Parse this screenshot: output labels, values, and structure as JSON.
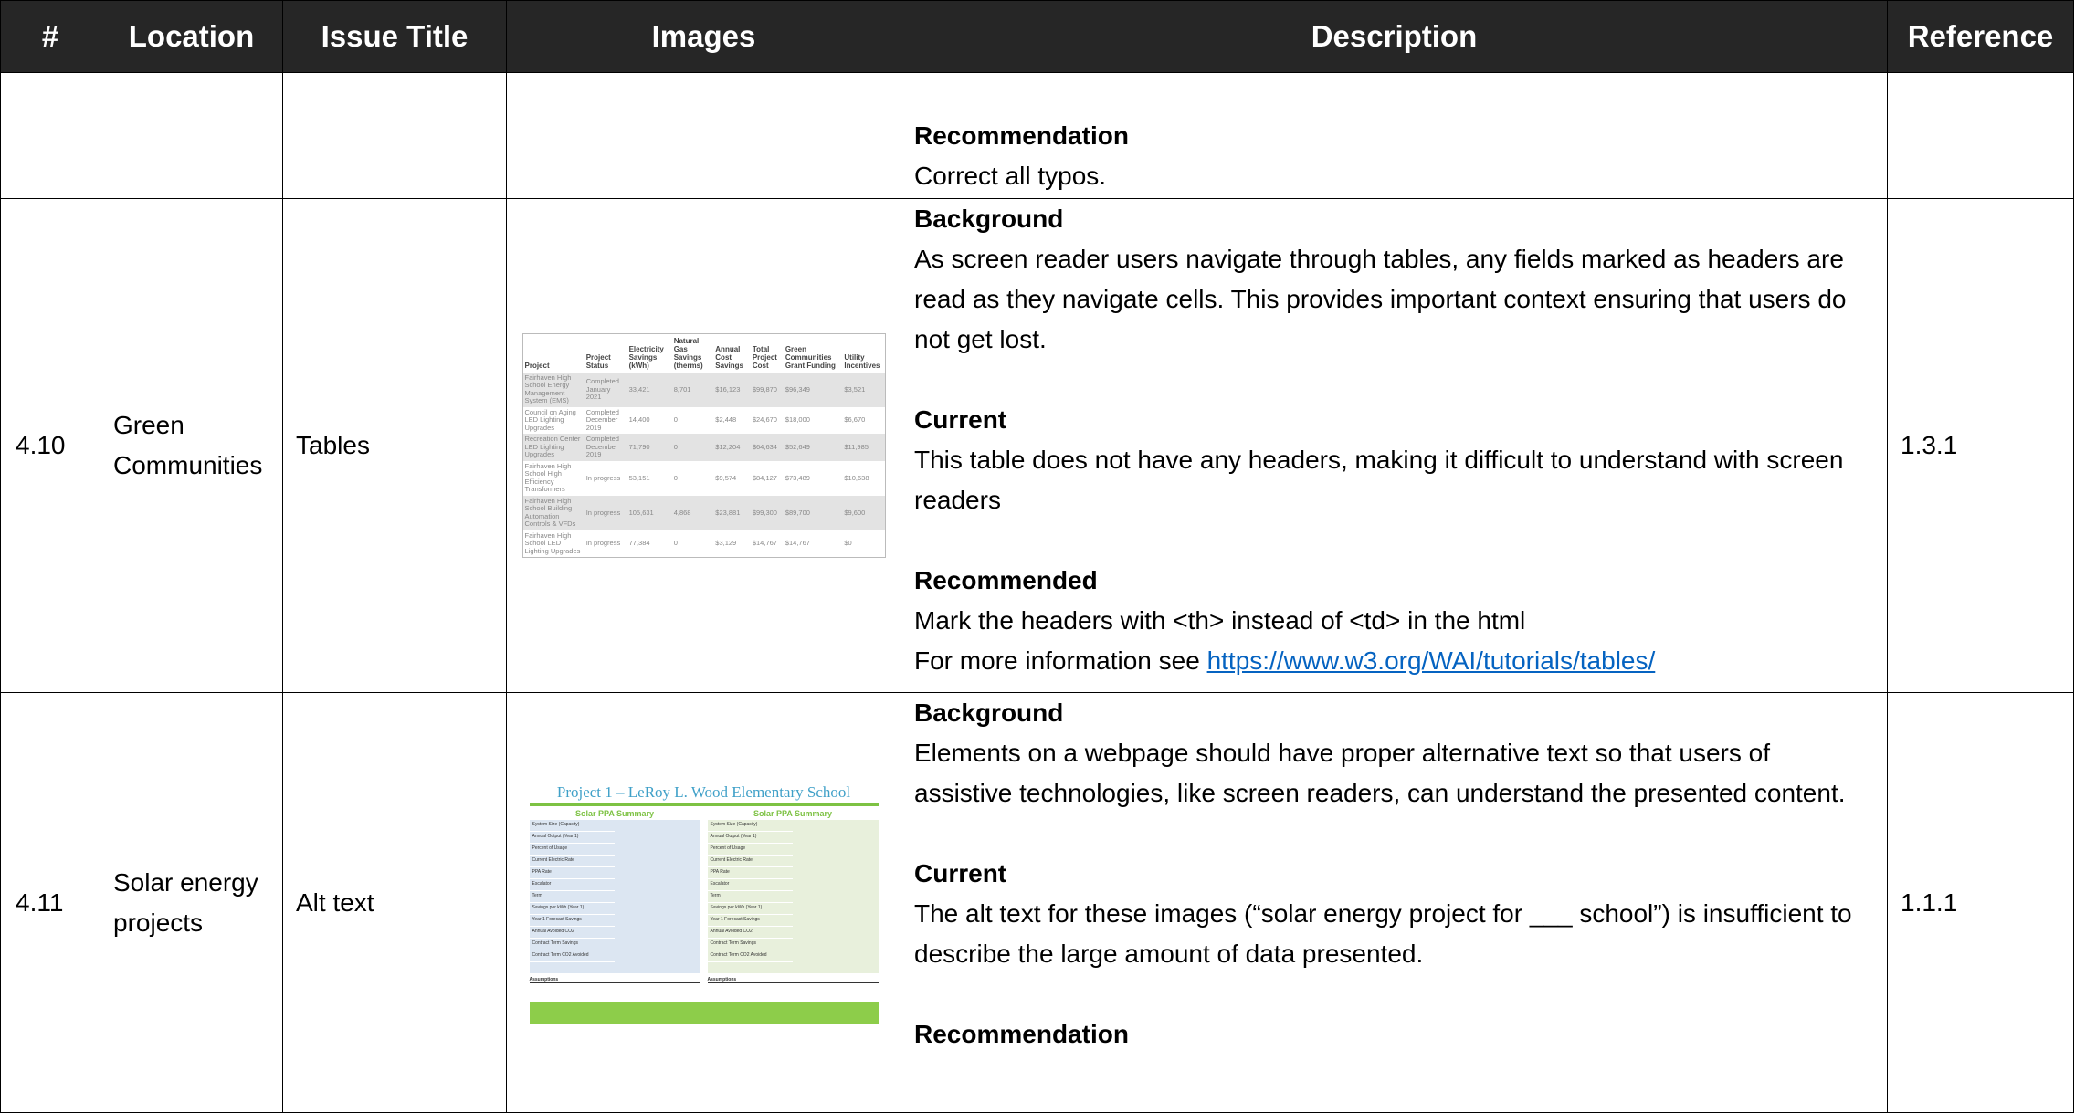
{
  "headers": [
    "#",
    "Location",
    "Issue Title",
    "Images",
    "Description",
    "Reference"
  ],
  "rows": [
    {
      "num": "",
      "location": "",
      "issue": "",
      "reference": "",
      "recommendation_label": "Recommendation",
      "recommendation_text": "Correct all typos."
    },
    {
      "num": "4.10",
      "location": "Green Communities",
      "issue": "Tables",
      "reference": "1.3.1",
      "background_label": "Background",
      "background_text": "As screen reader users navigate through tables, any fields marked as headers are read as they navigate cells. This provides important context ensuring that users do not get lost.",
      "current_label": "Current",
      "current_text": "This table does not have any headers, making it difficult to understand with screen readers",
      "recommended_label": "Recommended",
      "recommended_text": "Mark the headers with <th> instead of <td> in the html",
      "more_info_prefix": "For more information see ",
      "more_info_link": "https://www.w3.org/WAI/tutorials/tables/",
      "thumbnail": {
        "columns": [
          "Project",
          "Project Status",
          "Electricity Savings (kWh)",
          "Natural Gas Savings (therms)",
          "Annual Cost Savings",
          "Total Project Cost",
          "Green Communities Grant Funding",
          "Utility Incentives"
        ],
        "rows": [
          [
            "Fairhaven High School Energy Management System (EMS)",
            "Completed January 2021",
            "33,421",
            "8,701",
            "$16,123",
            "$99,870",
            "$96,349",
            "$3,521"
          ],
          [
            "Council on Aging LED Lighting Upgrades",
            "Completed December 2019",
            "14,400",
            "0",
            "$2,448",
            "$24,670",
            "$18,000",
            "$6,670"
          ],
          [
            "Recreation Center LED Lighting Upgrades",
            "Completed December 2019",
            "71,790",
            "0",
            "$12,204",
            "$64,634",
            "$52,649",
            "$11,985"
          ],
          [
            "Fairhaven High School High Efficiency Transformers",
            "In progress",
            "53,151",
            "0",
            "$9,574",
            "$84,127",
            "$73,489",
            "$10,638"
          ],
          [
            "Fairhaven High School Building Automation Controls & VFDs",
            "In progress",
            "105,631",
            "4,868",
            "$23,881",
            "$99,300",
            "$89,700",
            "$9,600"
          ],
          [
            "Fairhaven High School LED Lighting Upgrades",
            "In progress",
            "77,384",
            "0",
            "$3,129",
            "$14,767",
            "$14,767",
            "$0"
          ]
        ]
      }
    },
    {
      "num": "4.11",
      "location": "Solar energy projects",
      "issue": "Alt text",
      "reference": "1.1.1",
      "background_label": "Background",
      "background_text": "Elements on a webpage should have proper alternative text so that users of assistive technologies, like screen readers, can understand the presented content.",
      "current_label": "Current",
      "current_text": "The alt text for these images (“solar energy project for ___ school”) is insufficient to describe the large amount of data presented.",
      "recommendation_label": "Recommendation",
      "thumbnail": {
        "title": "Project 1 – LeRoy L. Wood Elementary School",
        "left_heading": "Solar PPA Summary",
        "right_heading": "Solar PPA Summary",
        "left_rows": [
          "System Size (Capacity)",
          "Annual Output (Year 1)",
          "Percent of Usage",
          "Current Electric Rate",
          "PPA Rate",
          "Escalator",
          "Term",
          "Savings per kWh (Year 1)",
          "Year 1 Forecast Savings",
          "Annual Avoided CO2",
          "Contract Term Savings",
          "Contract Term CO2 Avoided"
        ],
        "right_rows": [
          "System Size (Capacity)",
          "Annual Output (Year 1)",
          "Percent of Usage",
          "Current Electric Rate",
          "PPA Rate",
          "Escalator",
          "Term",
          "Savings per kWh (Year 1)",
          "Year 1 Forecast Savings",
          "Annual Avoided CO2",
          "Contract Term Savings",
          "Contract Term CO2 Avoided"
        ],
        "left_assumptions": "Assumptions",
        "right_assumptions": "Assumptions"
      }
    }
  ]
}
